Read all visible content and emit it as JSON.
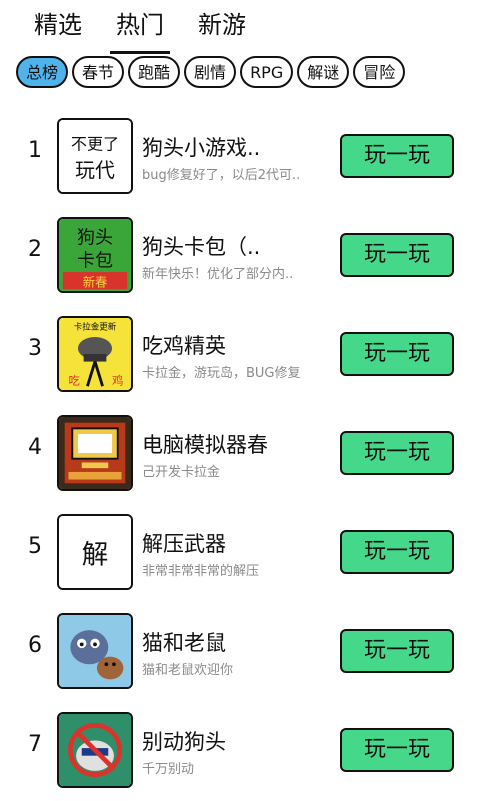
{
  "top_tabs": [
    {
      "label": "精选"
    },
    {
      "label": "热门"
    },
    {
      "label": "新游"
    }
  ],
  "active_top_tab": "热门",
  "categories": [
    {
      "label": "总榜"
    },
    {
      "label": "春节"
    },
    {
      "label": "跑酷"
    },
    {
      "label": "剧情"
    },
    {
      "label": "RPG"
    },
    {
      "label": "解谜"
    },
    {
      "label": "冒险"
    }
  ],
  "active_category": "总榜",
  "play_label": "玩一玩",
  "games": [
    {
      "rank": "1",
      "title": "狗头小游戏..",
      "desc": "bug修复好了，以后2代可..",
      "icon_text": "不更了 玩代",
      "icon": "handwritten-icon"
    },
    {
      "rank": "2",
      "title": "狗头卡包（..",
      "desc": "新年快乐！优化了部分内..",
      "icon_text": "狗头 卡包 新春",
      "icon": "card-pack-icon"
    },
    {
      "rank": "3",
      "title": "吃鸡精英",
      "desc": "卡拉金，游玩岛，BUG修复",
      "icon_text": "卡拉金更新 吃鸡",
      "icon": "helmet-icon"
    },
    {
      "rank": "4",
      "title": "电脑模拟器春",
      "desc": "己开发卡拉金",
      "icon_text": "",
      "icon": "computer-icon"
    },
    {
      "rank": "5",
      "title": "解压武器",
      "desc": "非常非常非常的解压",
      "icon_text": "解",
      "icon": "handwritten-icon"
    },
    {
      "rank": "6",
      "title": "猫和老鼠",
      "desc": "猫和老鼠欢迎你",
      "icon_text": "",
      "icon": "cat-mouse-icon"
    },
    {
      "rank": "7",
      "title": "别动狗头",
      "desc": "千万别动",
      "icon_text": "",
      "icon": "no-dog-icon"
    }
  ],
  "colors": {
    "accent_blue": "#4fb4ec",
    "play_green": "#45d88a",
    "muted_text": "#8a8a8a"
  }
}
